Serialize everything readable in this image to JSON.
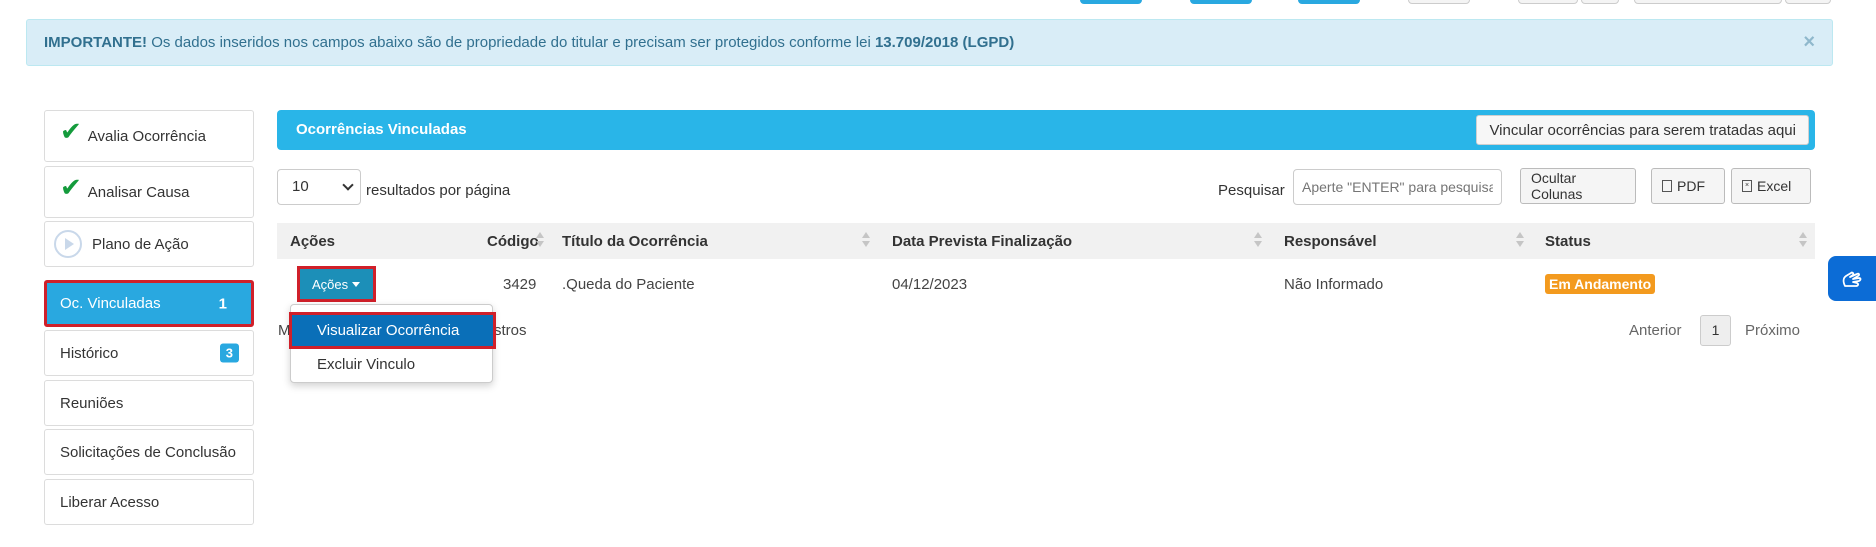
{
  "alert": {
    "strong": "IMPORTANTE!",
    "text": " Os dados inseridos nos campos abaixo são de propriedade do titular e precisam ser protegidos conforme lei ",
    "law": "13.709/2018 (LGPD)",
    "close": "×"
  },
  "sidebar": {
    "items": [
      {
        "label": "Avalia Ocorrência"
      },
      {
        "label": "Analisar Causa"
      },
      {
        "label": "Plano de Ação"
      },
      {
        "label": "Oc. Vinculadas",
        "badge": "1"
      },
      {
        "label": "Histórico",
        "badge": "3"
      },
      {
        "label": "Reuniões"
      },
      {
        "label": "Solicitações de Conclusão"
      },
      {
        "label": "Liberar Acesso"
      }
    ]
  },
  "panel": {
    "title": "Ocorrências Vinculadas",
    "link_button": "Vincular ocorrências para serem tratadas aqui"
  },
  "controls": {
    "page_size": "10",
    "per_page_label": "resultados por página",
    "search_label": "Pesquisar",
    "search_placeholder": "Aperte \"ENTER\" para pesquisar",
    "hide_columns": "Ocultar Colunas",
    "pdf": "PDF",
    "excel": "Excel"
  },
  "table": {
    "headers": [
      "Ações",
      "Código",
      "Título da Ocorrência",
      "Data Prevista Finalização",
      "Responsável",
      "Status"
    ],
    "row": {
      "action_button": "Ações",
      "code": "3429",
      "title": ".Queda do Paciente",
      "date": "04/12/2023",
      "responsible": "Não Informado",
      "status": "Em Andamento"
    }
  },
  "dropdown": {
    "items": [
      "Visualizar Ocorrência",
      "Excluir Vinculo"
    ]
  },
  "footer": {
    "info_start": "M",
    "info_end": "stros",
    "previous": "Anterior",
    "page": "1",
    "next": "Próximo"
  },
  "colors": {
    "primary": "#29b5e8",
    "highlight_border": "#d0202a",
    "status": "#f39a1e",
    "check": "#149b3c"
  },
  "icons": [
    "check-icon",
    "play-circle-icon",
    "caret-down-icon",
    "sort-icon",
    "file-pdf-icon",
    "file-excel-icon",
    "close-icon",
    "sign-language-icon"
  ]
}
